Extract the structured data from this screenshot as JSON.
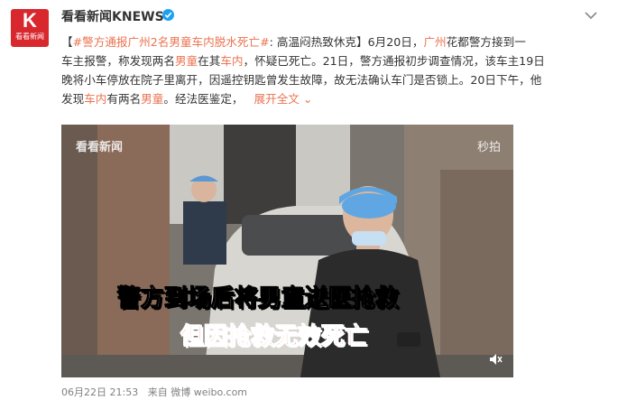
{
  "account": {
    "logo_char": "K",
    "logo_text": "看看新闻",
    "name": "看看新闻KNEWS"
  },
  "post": {
    "line1_open": "【",
    "topic": "#警方通报广州2名男童车内脱水死亡#",
    "line1_rest": ": 高温闷热致休克】6月20日，",
    "line1_city": "广州",
    "line1_end": "花都警方接到一",
    "line2_a": "车主报警，称发现两名",
    "line2_b": "男童",
    "line2_c": "在其",
    "line2_d": "车内",
    "line2_e": "，怀疑已死亡。21日，警方通报初步调查情况，该车主19日",
    "line3": "晚将小车停放在院子里离开，因遥控钥匙曾发生故障，故无法确认车门是否锁上。20日下午，他",
    "line4_a": "发现",
    "line4_b": "车内",
    "line4_c": "有两名",
    "line4_d": "男童",
    "line4_e": "。经法医鉴定，",
    "expand": "展开全文"
  },
  "video": {
    "watermark_left": "看看新闻",
    "watermark_right": "秒拍",
    "caption1": "警方到场后将男童送医抢救",
    "caption2": "但因抢救无效死亡"
  },
  "meta": {
    "time": "06月22日 21:53",
    "source": "来自 微博 weibo.com"
  },
  "colors": {
    "brand": "#d9272e",
    "link": "#eb7350",
    "verified": "#1da1f2"
  }
}
